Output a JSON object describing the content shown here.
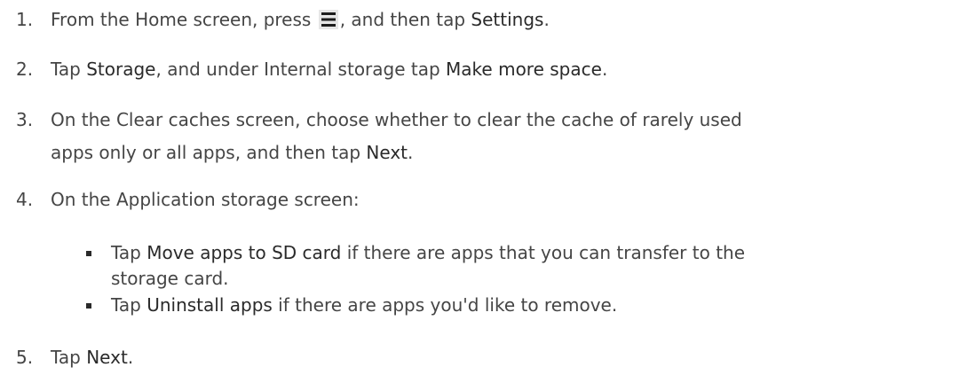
{
  "steps": [
    {
      "number": "1.",
      "lines": [
        {
          "parts": [
            "From the Home screen, press ",
            "",
            ", and then tap ",
            "Settings",
            "."
          ]
        }
      ]
    },
    {
      "number": "2.",
      "lines": [
        {
          "parts": [
            "Tap ",
            "Storage",
            ", and under Internal storage tap ",
            "Make more space",
            "."
          ]
        }
      ]
    },
    {
      "number": "3.",
      "lines": [
        {
          "text": "On the Clear caches screen, choose whether to clear the cache of rarely used"
        },
        {
          "parts": [
            "apps only or all apps, and then tap ",
            "Next",
            "."
          ]
        }
      ]
    },
    {
      "number": "4.",
      "lines": [
        {
          "text": "On the Application storage screen:"
        }
      ]
    },
    {
      "number": "5.",
      "lines": [
        {
          "parts": [
            "Tap ",
            "Next",
            "."
          ]
        }
      ]
    }
  ],
  "substeps": [
    {
      "lines": [
        {
          "parts": [
            "Tap ",
            "Move apps to SD card",
            " if there are apps that you can transfer to the"
          ]
        },
        {
          "text": "storage card."
        }
      ]
    },
    {
      "lines": [
        {
          "parts": [
            "Tap ",
            "Uninstall apps",
            " if there are apps you'd like to remove."
          ]
        }
      ]
    }
  ],
  "icons": {
    "menu": "menu-icon"
  }
}
